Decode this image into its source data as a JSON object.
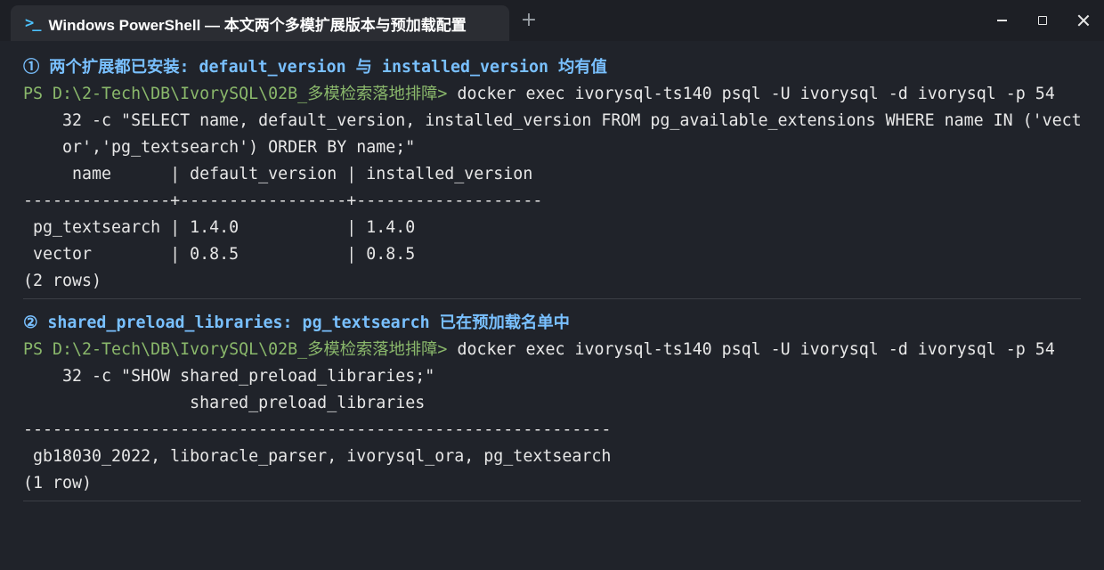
{
  "titlebar": {
    "tab_icon": ">_",
    "tab_title": "Windows PowerShell — 本文两个多模扩展版本与预加载配置",
    "new_tab_label": "+"
  },
  "section1": {
    "heading": "① 两个扩展都已安装: default_version 与 installed_version 均有值",
    "prompt": "PS D:\\2-Tech\\DB\\IvorySQL\\02B_多模检索落地排障>",
    "command_line1": " docker exec ivorysql-ts140 psql -U ivorysql -d ivorysql -p 54",
    "command_line2": "    32 -c \"SELECT name, default_version, installed_version FROM pg_available_extensions WHERE name IN ('vect",
    "command_line3": "    or','pg_textsearch') ORDER BY name;\"",
    "table_header": "     name      | default_version | installed_version",
    "table_separator": "---------------+-----------------+-------------------",
    "rows": [
      " pg_textsearch | 1.4.0           | 1.4.0",
      " vector        | 0.8.5           | 0.8.5"
    ],
    "row_count": "(2 rows)"
  },
  "section2": {
    "heading": "② shared_preload_libraries: pg_textsearch 已在预加载名单中",
    "prompt": "PS D:\\2-Tech\\DB\\IvorySQL\\02B_多模检索落地排障>",
    "command_line1": " docker exec ivorysql-ts140 psql -U ivorysql -d ivorysql -p 54",
    "command_line2": "    32 -c \"SHOW shared_preload_libraries;\"",
    "table_header": "                 shared_preload_libraries",
    "table_separator": "------------------------------------------------------------",
    "rows": [
      " gb18030_2022, liboracle_parser, ivorysql_ora, pg_textsearch"
    ],
    "row_count": "(1 row)"
  },
  "colors": {
    "background": "#20232a",
    "heading": "#79c0ff",
    "prompt": "#8ab86b",
    "text": "#e6e6e6"
  }
}
